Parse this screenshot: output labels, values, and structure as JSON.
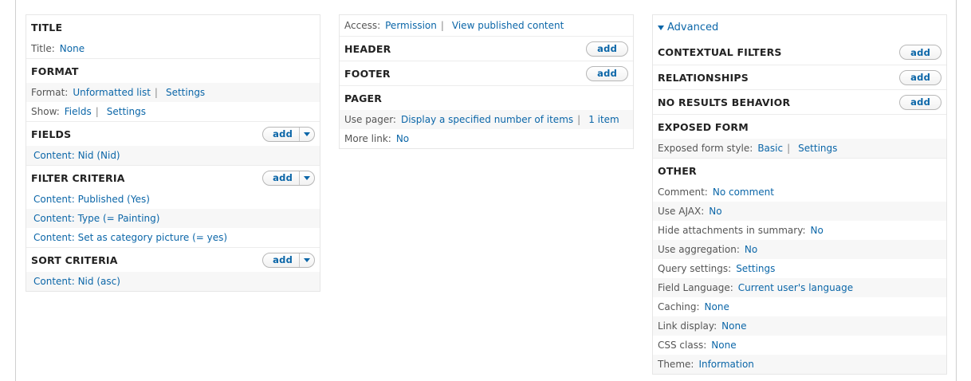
{
  "col1": {
    "title": {
      "heading": "TITLE",
      "title_label": "Title:",
      "title_value": "None"
    },
    "format": {
      "heading": "FORMAT",
      "format_label": "Format:",
      "format_value": "Unformatted list",
      "format_settings": "Settings",
      "show_label": "Show:",
      "show_value": "Fields",
      "show_settings": "Settings"
    },
    "fields": {
      "heading": "FIELDS",
      "add_label": "add",
      "items": [
        "Content: Nid (Nid)"
      ]
    },
    "filter_criteria": {
      "heading": "FILTER CRITERIA",
      "add_label": "add",
      "items": [
        "Content: Published (Yes)",
        "Content: Type (= Painting)",
        "Content: Set as category picture (= yes)"
      ]
    },
    "sort_criteria": {
      "heading": "SORT CRITERIA",
      "add_label": "add",
      "items": [
        "Content: Nid (asc)"
      ]
    }
  },
  "col2": {
    "access": {
      "label": "Access:",
      "value": "Permission",
      "detail": "View published content"
    },
    "header": {
      "heading": "HEADER",
      "add_label": "add"
    },
    "footer": {
      "heading": "FOOTER",
      "add_label": "add"
    },
    "pager": {
      "heading": "PAGER",
      "use_pager_label": "Use pager:",
      "use_pager_value": "Display a specified number of items",
      "use_pager_count": "1 item",
      "more_link_label": "More link:",
      "more_link_value": "No"
    }
  },
  "col3": {
    "advanced_label": "Advanced",
    "contextual_filters": {
      "heading": "CONTEXTUAL FILTERS",
      "add_label": "add"
    },
    "relationships": {
      "heading": "RELATIONSHIPS",
      "add_label": "add"
    },
    "no_results": {
      "heading": "NO RESULTS BEHAVIOR",
      "add_label": "add"
    },
    "exposed_form": {
      "heading": "EXPOSED FORM",
      "style_label": "Exposed form style:",
      "style_value": "Basic",
      "style_settings": "Settings"
    },
    "other": {
      "heading": "OTHER",
      "rows": [
        {
          "label": "Comment:",
          "value": "No comment"
        },
        {
          "label": "Use AJAX:",
          "value": "No"
        },
        {
          "label": "Hide attachments in summary:",
          "value": "No"
        },
        {
          "label": "Use aggregation:",
          "value": "No"
        },
        {
          "label": "Query settings:",
          "value": "Settings"
        },
        {
          "label": "Field Language:",
          "value": "Current user's language"
        },
        {
          "label": "Caching:",
          "value": "None"
        },
        {
          "label": "Link display:",
          "value": "None"
        },
        {
          "label": "CSS class:",
          "value": "None"
        },
        {
          "label": "Theme:",
          "value": "Information"
        }
      ]
    }
  },
  "colors": {
    "link": "#0b66a8",
    "row_shade": "#f7f7f7",
    "border": "#e6e6e6"
  },
  "icons": {
    "add_dropdown": "chevron-down-icon",
    "advanced_toggle": "triangle-down-icon"
  }
}
